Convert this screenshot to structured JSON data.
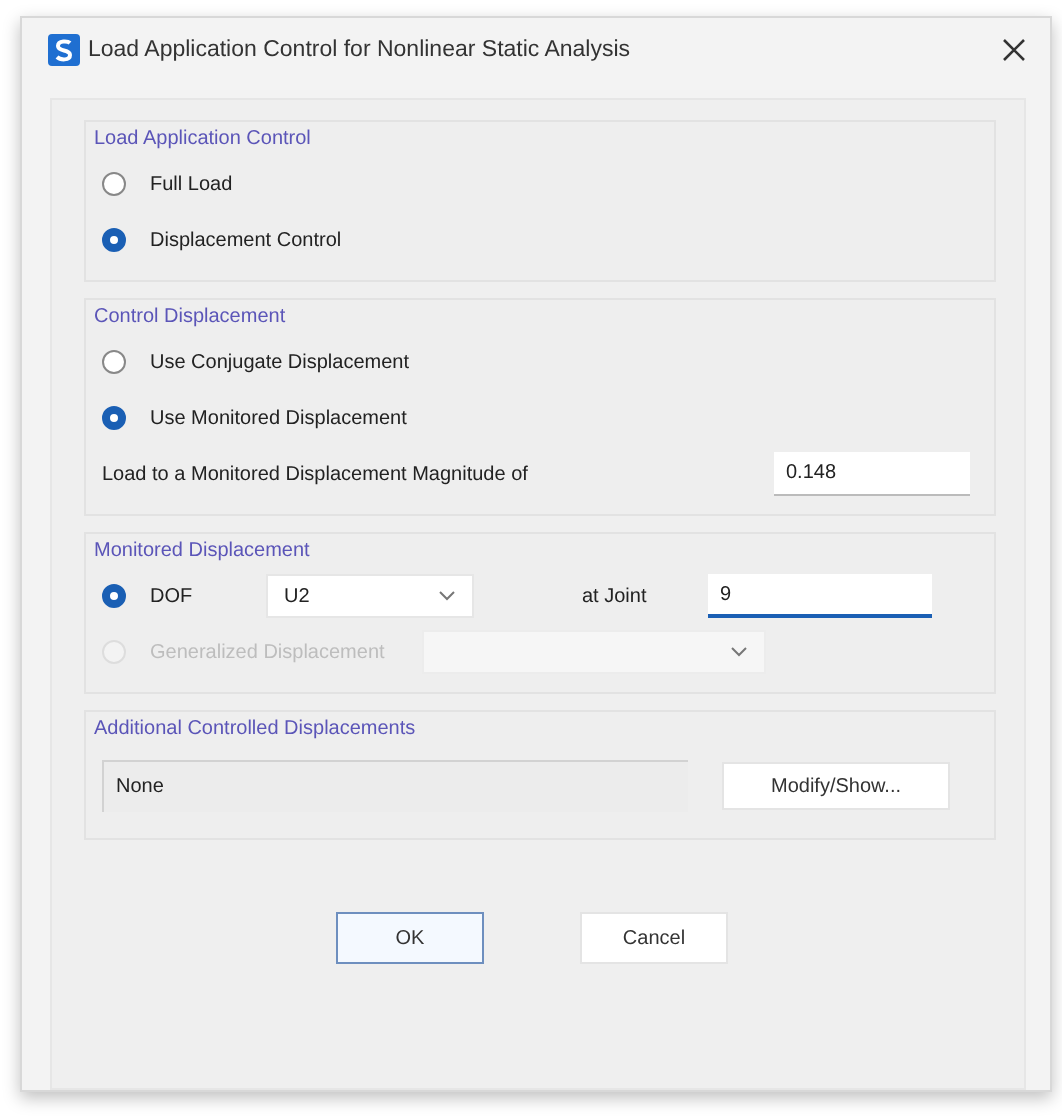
{
  "window": {
    "title": "Load Application Control for Nonlinear Static Analysis"
  },
  "load_application_control": {
    "title": "Load Application Control",
    "options": [
      {
        "label": "Full Load",
        "selected": false
      },
      {
        "label": "Displacement Control",
        "selected": true
      }
    ]
  },
  "control_displacement": {
    "title": "Control Displacement",
    "options": [
      {
        "label": "Use Conjugate Displacement",
        "selected": false
      },
      {
        "label": "Use Monitored Displacement",
        "selected": true
      }
    ],
    "magnitude": {
      "label": "Load to a Monitored Displacement Magnitude of",
      "value": "0.148"
    }
  },
  "monitored_displacement": {
    "title": "Monitored Displacement",
    "options": [
      {
        "label": "DOF",
        "selected": true,
        "disabled": false,
        "dropdown": "U2"
      },
      {
        "label": "Generalized Displacement",
        "selected": false,
        "disabled": true
      }
    ],
    "joint": {
      "label": "at Joint",
      "value": "9",
      "focused": true
    }
  },
  "additional_controlled_displacements": {
    "title": "Additional Controlled Displacements",
    "list_value": "None",
    "button": "Modify/Show..."
  },
  "buttons": [
    {
      "label": "OK",
      "default": true
    },
    {
      "label": "Cancel",
      "default": false
    }
  ]
}
